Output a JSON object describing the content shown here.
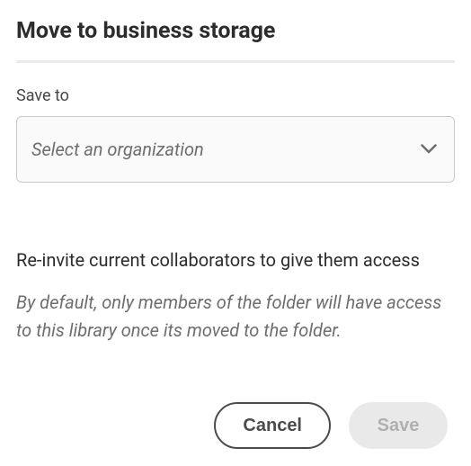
{
  "dialog": {
    "title": "Move to business storage"
  },
  "field": {
    "label": "Save to",
    "placeholder": "Select an organization"
  },
  "reinvite": {
    "heading": "Re-invite current collaborators to give them access",
    "description": "By default, only members of the folder will have access to this library once its moved to the folder."
  },
  "buttons": {
    "cancel": "Cancel",
    "save": "Save"
  }
}
